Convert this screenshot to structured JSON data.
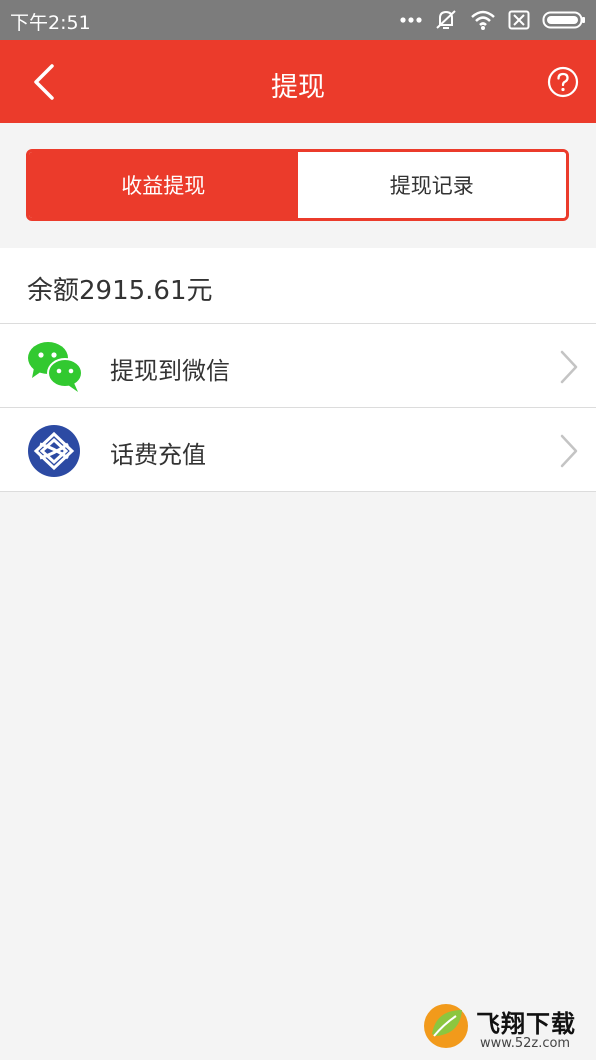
{
  "status_bar": {
    "time": "下午2:51",
    "icons": [
      "more-dots-icon",
      "mute-icon",
      "wifi-icon",
      "sim-off-icon",
      "battery-icon"
    ]
  },
  "header": {
    "title": "提现",
    "back_icon": "chevron-left-icon",
    "help_icon": "help-circle-icon",
    "color": "#eb3b2b"
  },
  "tabs": [
    {
      "label": "收益提现",
      "active": true
    },
    {
      "label": "提现记录",
      "active": false
    }
  ],
  "balance": {
    "text": "余额2915.61元"
  },
  "options": [
    {
      "label": "提现到微信",
      "icon": "wechat-icon",
      "icon_color": "#32c930"
    },
    {
      "label": "话费充值",
      "icon": "china-mobile-icon",
      "icon_color": "#2c4aa3"
    }
  ],
  "watermark": {
    "name": "飞翔下载",
    "url": "www.52z.com"
  }
}
